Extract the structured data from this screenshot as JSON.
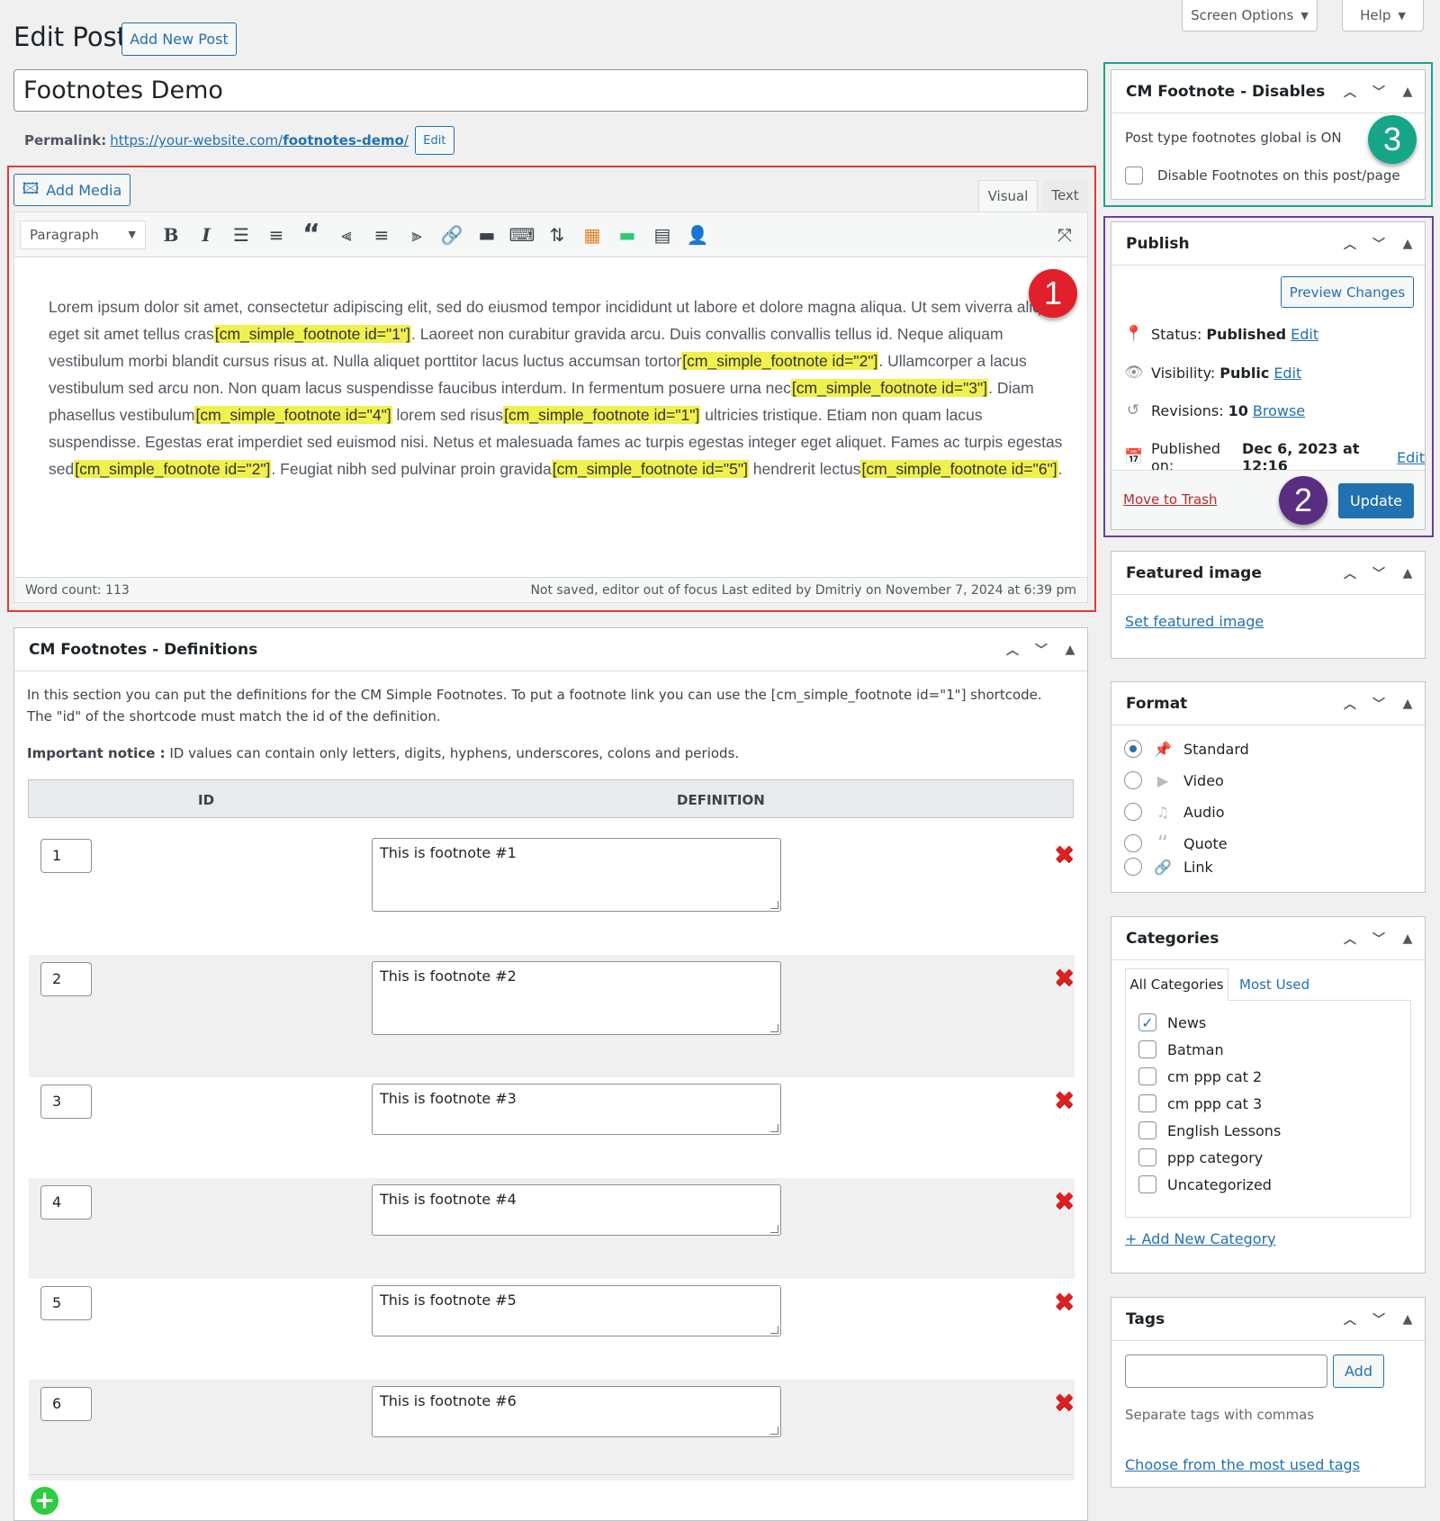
{
  "top": {
    "screen_options": "Screen Options",
    "help": "Help"
  },
  "header": {
    "title": "Edit Post",
    "add_new": "Add New Post"
  },
  "post": {
    "title": "Footnotes Demo",
    "permalink_label": "Permalink:",
    "permalink_base": "https://your-website.com/",
    "permalink_slug": "footnotes-demo",
    "permalink_end": "/",
    "permalink_edit": "Edit"
  },
  "editor": {
    "add_media": "Add Media",
    "tab_visual": "Visual",
    "tab_text": "Text",
    "format_select": "Paragraph",
    "content": [
      {
        "t": "Lorem ipsum dolor sit amet, consectetur adipiscing elit, sed do eiusmod tempor incididunt ut labore et dolore magna aliqua. Ut sem viverra aliquet eget sit amet tellus cras"
      },
      {
        "t": "[cm_simple_footnote id=\"1\"]",
        "hl": true
      },
      {
        "t": ". Laoreet non curabitur gravida arcu. Duis convallis convallis tellus id. Neque aliquam vestibulum morbi blandit cursus risus at. Nulla aliquet porttitor lacus luctus accumsan tortor"
      },
      {
        "t": "[cm_simple_footnote id=\"2\"]",
        "hl": true
      },
      {
        "t": ". Ullamcorper a lacus vestibulum sed arcu non. Non quam lacus suspendisse faucibus interdum. In fermentum posuere urna nec"
      },
      {
        "t": "[cm_simple_footnote id=\"3\"]",
        "hl": true
      },
      {
        "t": ". Diam phasellus vestibulum"
      },
      {
        "t": "[cm_simple_footnote id=\"4\"]",
        "hl": true
      },
      {
        "t": " lorem sed risus"
      },
      {
        "t": "[cm_simple_footnote id=\"1\"]",
        "hl": true
      },
      {
        "t": " ultricies tristique. Etiam non quam lacus suspendisse. Egestas erat imperdiet sed euismod nisi. Netus et malesuada fames ac turpis egestas integer eget aliquet. Fames ac turpis egestas sed"
      },
      {
        "t": "[cm_simple_footnote id=\"2\"]",
        "hl": true
      },
      {
        "t": ". Feugiat nibh sed pulvinar proin gravida"
      },
      {
        "t": "[cm_simple_footnote id=\"5\"]",
        "hl": true
      },
      {
        "t": " hendrerit lectus"
      },
      {
        "t": "[cm_simple_footnote id=\"6\"]",
        "hl": true
      },
      {
        "t": "."
      }
    ],
    "word_count": "Word count: 113",
    "status": "Not saved, editor out of focus Last edited by Dmitriy on November 7, 2024 at 6:39 pm"
  },
  "badges": {
    "one": "1",
    "two": "2",
    "three": "3"
  },
  "definitions": {
    "title": "CM Footnotes - Definitions",
    "intro": "In this section you can put the definitions for the CM Simple Footnotes. To put a footnote link you can use the [cm_simple_footnote id=\"1\"] shortcode. The \"id\" of the shortcode must match the id of the definition.",
    "notice_label": "Important notice :",
    "notice_text": " ID values can contain only letters, digits, hyphens, underscores, colons and periods.",
    "col_id": "ID",
    "col_def": "DEFINITION",
    "rows": [
      {
        "id": "1",
        "def": "This is footnote #1"
      },
      {
        "id": "2",
        "def": "This is footnote #2"
      },
      {
        "id": "3",
        "def": "This is footnote #3"
      },
      {
        "id": "4",
        "def": "This is footnote #4"
      },
      {
        "id": "5",
        "def": "This is footnote #5"
      },
      {
        "id": "6",
        "def": "This is footnote #6"
      }
    ]
  },
  "disables": {
    "title": "CM Footnote - Disables",
    "global_text": "Post type footnotes global is ON",
    "checkbox_label": "Disable Footnotes on this post/page"
  },
  "publish": {
    "title": "Publish",
    "preview": "Preview Changes",
    "status_label": "Status:",
    "status_value": "Published",
    "status_edit": "Edit",
    "visibility_label": "Visibility:",
    "visibility_value": "Public",
    "visibility_edit": "Edit",
    "revisions_label": "Revisions:",
    "revisions_value": "10",
    "revisions_browse": "Browse",
    "published_label": "Published on:",
    "published_value": "Dec 6, 2023 at 12:16",
    "published_edit": "Edit",
    "trash": "Move to Trash",
    "update": "Update"
  },
  "featured": {
    "title": "Featured image",
    "link": "Set featured image"
  },
  "format": {
    "title": "Format",
    "options": [
      "Standard",
      "Video",
      "Audio",
      "Quote",
      "Link"
    ],
    "selected": "Standard"
  },
  "categories": {
    "title": "Categories",
    "tab_all": "All Categories",
    "tab_used": "Most Used",
    "items": [
      {
        "label": "News",
        "checked": true
      },
      {
        "label": "Batman",
        "checked": false
      },
      {
        "label": "cm ppp cat 2",
        "checked": false
      },
      {
        "label": "cm ppp cat 3",
        "checked": false
      },
      {
        "label": "English Lessons",
        "checked": false
      },
      {
        "label": "ppp category",
        "checked": false
      },
      {
        "label": "Uncategorized",
        "checked": false
      }
    ],
    "add_new": "+ Add New Category"
  },
  "tags": {
    "title": "Tags",
    "add": "Add",
    "hint": "Separate tags with commas",
    "choose": "Choose from the most used tags"
  },
  "colors": {
    "accent": "#2271b1",
    "badge1": "#e0202a",
    "badge2": "#5a2d82",
    "badge3": "#17a589",
    "outline_editor": "#e53935",
    "outline_publish": "#6a3fa0",
    "outline_disables": "#17a589"
  }
}
